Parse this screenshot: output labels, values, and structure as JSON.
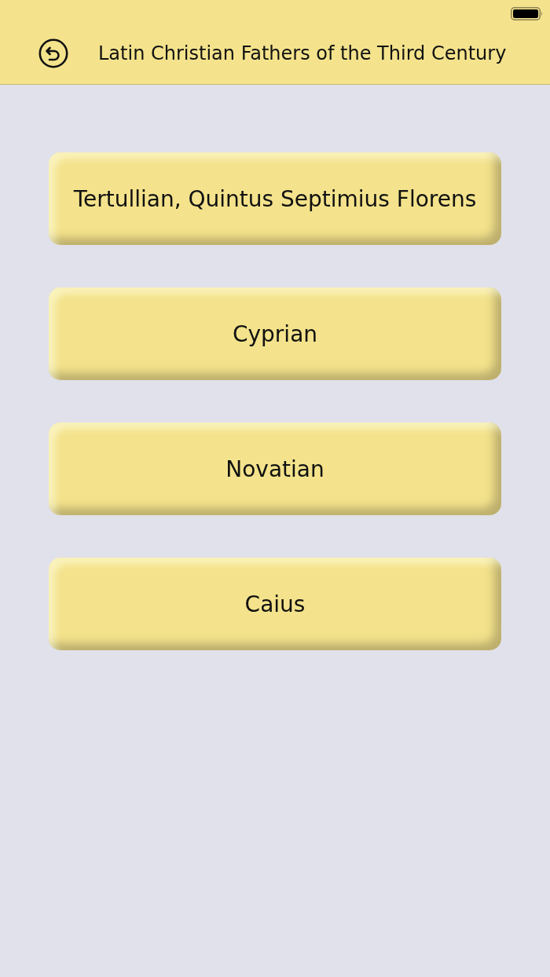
{
  "header": {
    "title": "Latin Christian Fathers of the Third Century"
  },
  "buttons": [
    {
      "label": "Tertullian, Quintus Septimius Florens"
    },
    {
      "label": "Cyprian"
    },
    {
      "label": "Novatian"
    },
    {
      "label": "Caius"
    }
  ]
}
